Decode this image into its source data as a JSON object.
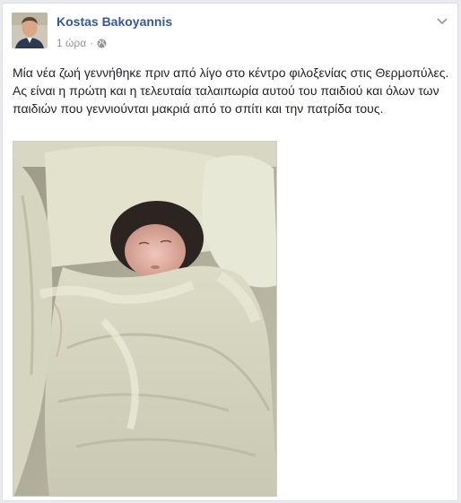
{
  "post": {
    "author_name": "Kostas Bakoyannis",
    "timestamp": "1 ώρα",
    "separator": "·",
    "privacy_icon": "globe-icon",
    "options_icon": "chevron-down-icon",
    "text": "Μία νέα ζωή γεννήθηκε πριν από λίγο στο κέντρο φιλοξενίας στις Θερμοπύλες. Ας είναι η πρώτη και η τελευταία ταλαιπωρία αυτού του παιδιού και όλων των παιδιών που γεννιούνται μακριά από το σπίτι και την πατρίδα τους."
  },
  "colors": {
    "author_link": "#365899",
    "meta_text": "#90949c",
    "body_text": "#1d2129",
    "card_border": "#dddfe2",
    "page_bg": "#e9ebee"
  }
}
